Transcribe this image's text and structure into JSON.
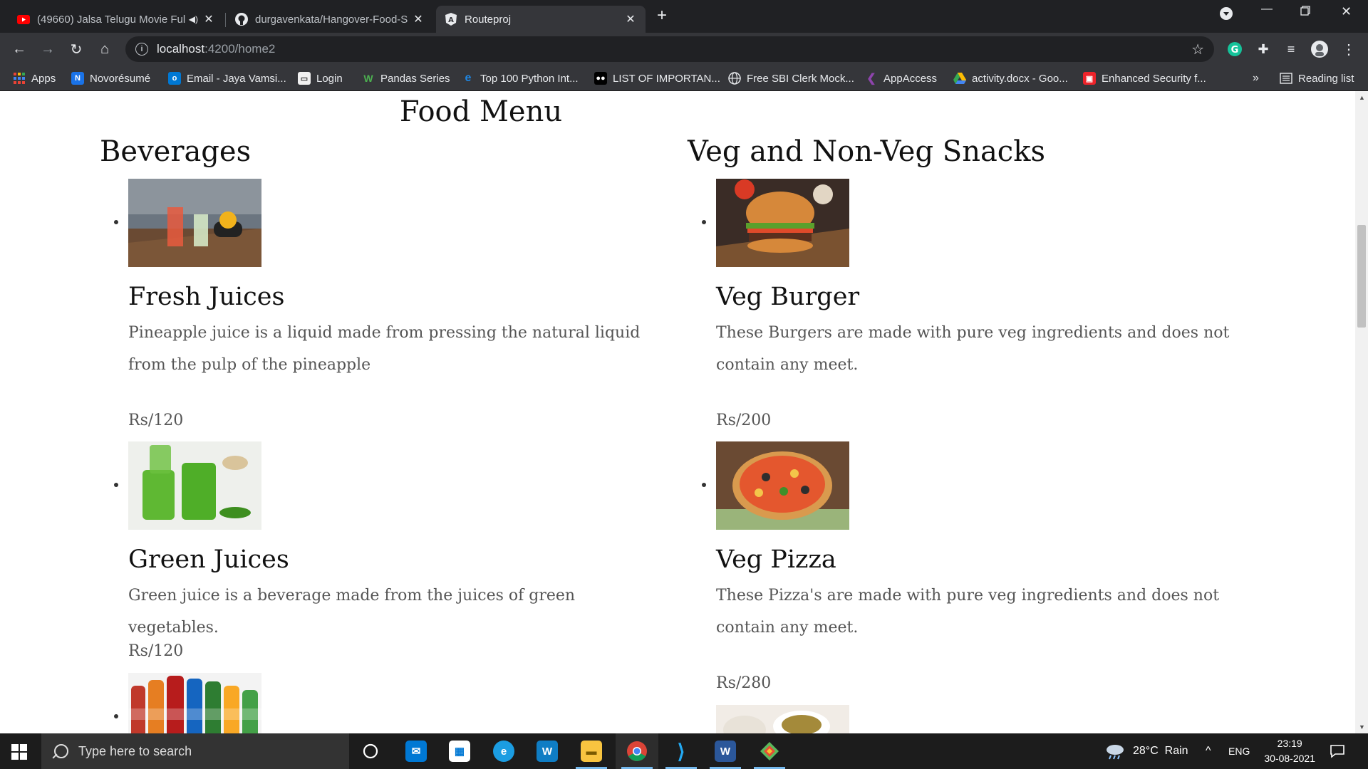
{
  "browser": {
    "tabs": [
      {
        "title": "(49660) Jalsa Telugu Movie Full",
        "icon": "youtube-icon",
        "audio": true
      },
      {
        "title": "durgavenkata/Hangover-Food-Sp",
        "icon": "github-icon"
      },
      {
        "title": "Routeproj",
        "icon": "angular-icon",
        "active": true
      }
    ],
    "url_host": "localhost",
    "url_rest": ":4200/home2",
    "bookmarks": [
      {
        "label": "Apps",
        "icon": "apps-grid-icon"
      },
      {
        "label": "Novorésumé",
        "icon": "novoresume-icon"
      },
      {
        "label": "Email - Jaya Vamsi...",
        "icon": "outlook-icon"
      },
      {
        "label": "Login",
        "icon": "login-page-icon"
      },
      {
        "label": "Pandas Series",
        "icon": "w3schools-icon"
      },
      {
        "label": "Top 100 Python Int...",
        "icon": "edureka-icon"
      },
      {
        "label": "LIST OF IMPORTAN...",
        "icon": "medium-icon"
      },
      {
        "label": "Free SBI Clerk Mock...",
        "icon": "globe-icon"
      },
      {
        "label": "AppAccess",
        "icon": "appaccess-icon"
      },
      {
        "label": "activity.docx - Goo...",
        "icon": "google-drive-icon"
      },
      {
        "label": "Enhanced Security f...",
        "icon": "hdfc-icon"
      }
    ],
    "more_bookmarks": "»",
    "reading_list": "Reading list"
  },
  "page": {
    "title": "Food Menu",
    "columns": [
      {
        "heading": "Beverages",
        "items": [
          {
            "name": "Fresh Juices",
            "description": "Pineapple juice is a liquid made from pressing the natural liquid from the pulp of the pineapple",
            "price": "Rs/120",
            "image": "fresh-juice-photo"
          },
          {
            "name": "Green Juices",
            "description": "Green juice is a beverage made from the juices of green vegetables.",
            "price": "Rs/120",
            "image": "green-juice-photo"
          },
          {
            "name": "",
            "description": "",
            "price": "",
            "image": "soft-drinks-photo"
          }
        ]
      },
      {
        "heading": "Veg and Non-Veg Snacks",
        "items": [
          {
            "name": "Veg Burger",
            "description": "These Burgers are made with pure veg ingredients and does not contain any meet.",
            "price": "Rs/200",
            "image": "burger-photo"
          },
          {
            "name": "Veg Pizza",
            "description": "These Pizza's are made with pure veg ingredients and does not contain any meet.",
            "price": "Rs/280",
            "image": "pizza-photo"
          },
          {
            "name": "",
            "description": "",
            "price": "",
            "image": "snack-photo"
          }
        ]
      }
    ]
  },
  "taskbar": {
    "search_placeholder": "Type here to search",
    "weather": "28°C  Rain",
    "language": "ENG",
    "time": "23:19",
    "date": "30-08-2021"
  }
}
